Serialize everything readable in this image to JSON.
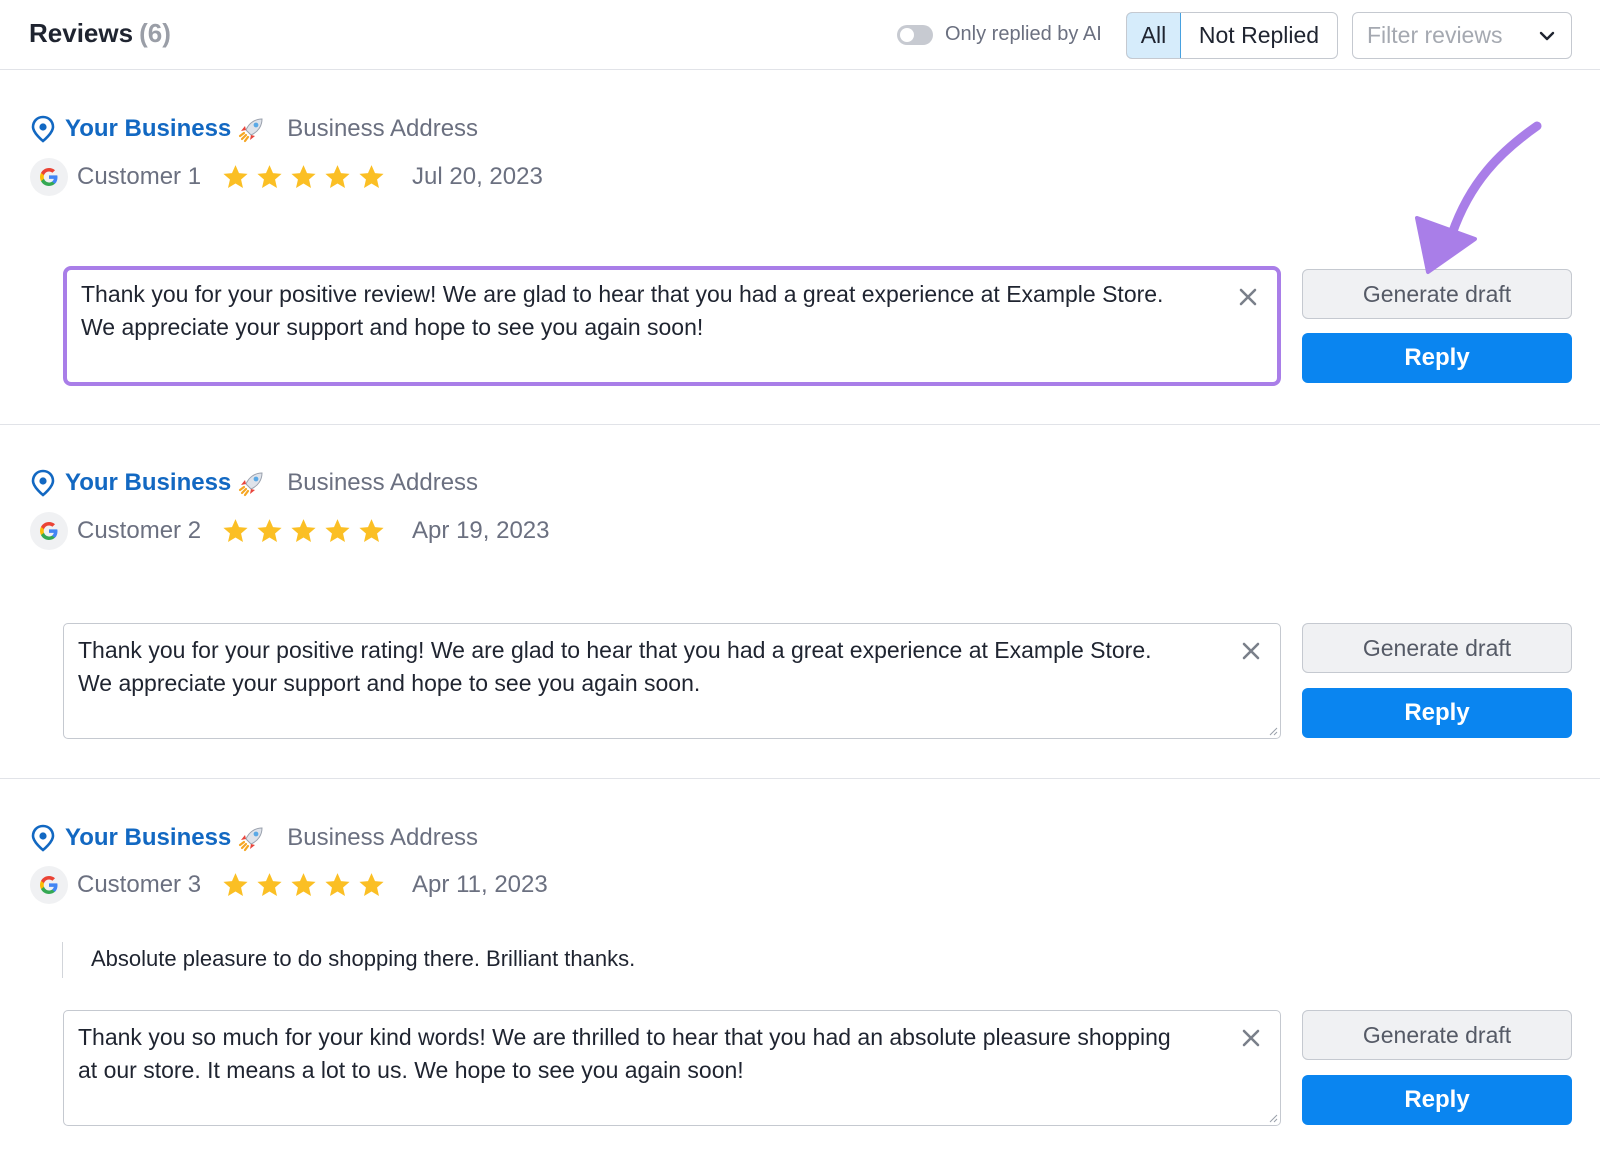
{
  "header": {
    "title": "Reviews",
    "count": "(6)",
    "toggle_label": "Only replied by AI",
    "toggle_on": false,
    "segments": {
      "all": "All",
      "not_replied": "Not Replied",
      "selected": "All"
    },
    "filter_placeholder": "Filter reviews"
  },
  "reviews": [
    {
      "business": "Your Business",
      "address": "Business Address",
      "customer": "Customer 1",
      "rating": 5,
      "date": "Jul 20, 2023",
      "text": "",
      "draft": "Thank you for your positive review! We are glad to hear that you had a great experience at Example Store. We appreciate your support and hope to see you again soon!",
      "generate_label": "Generate draft",
      "reply_label": "Reply"
    },
    {
      "business": "Your Business",
      "address": "Business Address",
      "customer": "Customer 2",
      "rating": 5,
      "date": "Apr 19, 2023",
      "text": "",
      "draft": "Thank you for your positive rating! We are glad to hear that you had a great experience at Example Store. We appreciate your support and hope to see you again soon.",
      "generate_label": "Generate draft",
      "reply_label": "Reply"
    },
    {
      "business": "Your Business",
      "address": "Business Address",
      "customer": "Customer 3",
      "rating": 5,
      "date": "Apr 11, 2023",
      "text": "Absolute pleasure to do shopping there. Brilliant thanks.",
      "draft": "Thank you so much for your kind words! We are thrilled to hear that you had an absolute pleasure shopping at our store. It means a lot to us. We hope to see you again soon!",
      "generate_label": "Generate draft",
      "reply_label": "Reply"
    }
  ],
  "colors": {
    "accent": "#0a85f0",
    "business_link": "#1268c2",
    "star": "#fbbf24",
    "highlight": "#a97ee8"
  }
}
